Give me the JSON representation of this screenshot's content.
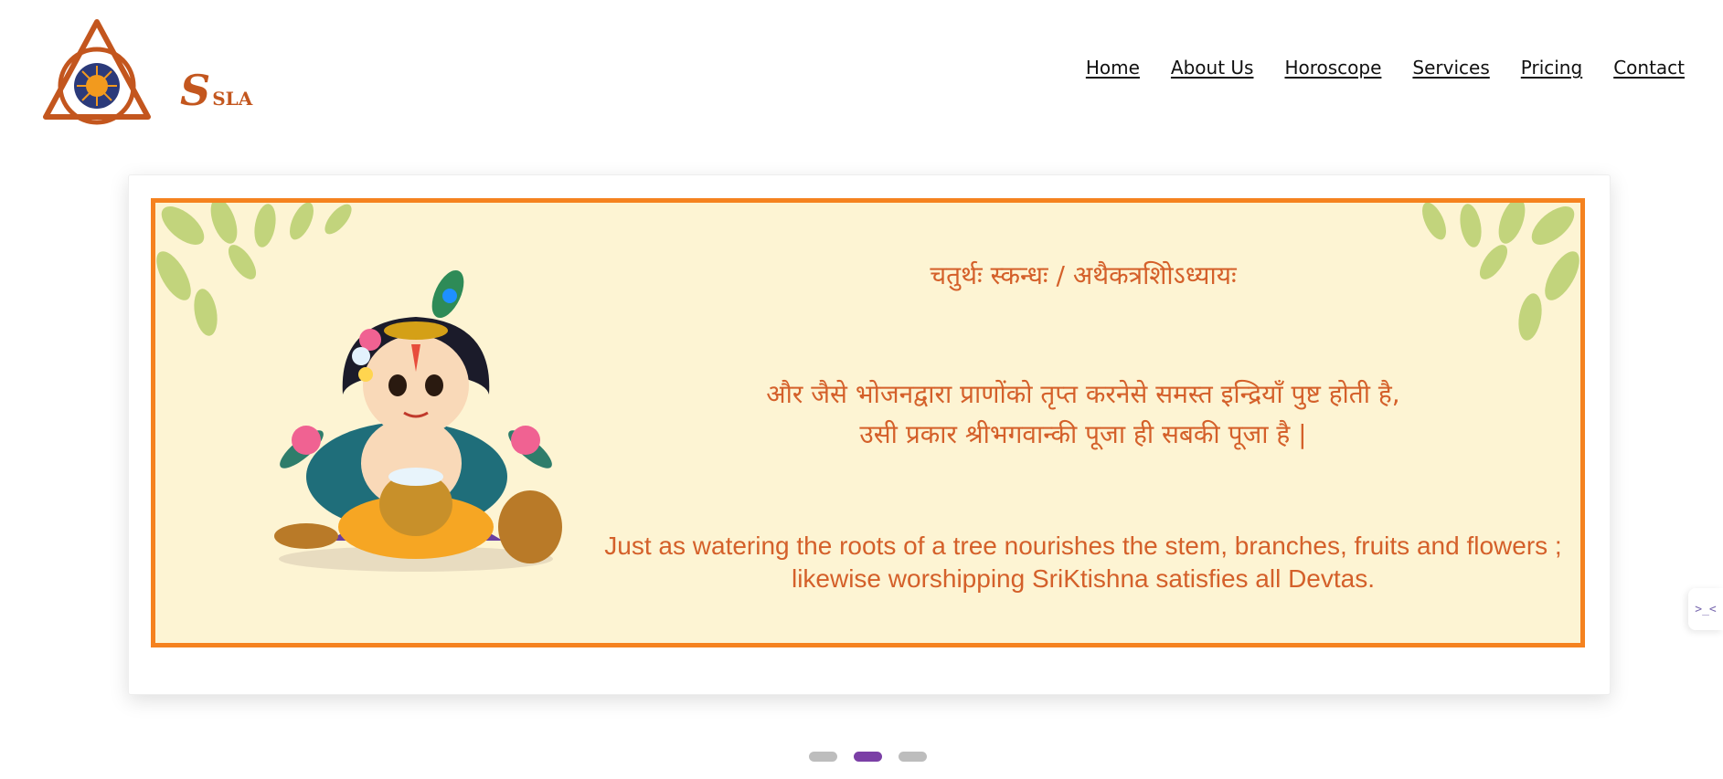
{
  "logo": {
    "letter": "S",
    "text": "SLA"
  },
  "nav": {
    "items": [
      {
        "label": "Home"
      },
      {
        "label": "About Us"
      },
      {
        "label": "Horoscope"
      },
      {
        "label": "Services"
      },
      {
        "label": "Pricing"
      },
      {
        "label": "Contact"
      }
    ]
  },
  "slide": {
    "title": "चतुर्थः स्कन्धः / अथैकत्रशिोऽध्यायः",
    "hindi_line_1": "और जैसे भोजनद्वारा प्राणोंको तृप्त करनेसे समस्त इन्द्रियाँ पुष्ट होती है,",
    "hindi_line_2": "उसी प्रकार श्रीभगवान्की पूजा ही सबकी पूजा है |",
    "english_line_1": "Just as watering the roots of a tree nourishes the stem, branches, fruits and flowers ;",
    "english_line_2": "likewise worshipping SriKtishna satisfies all Devtas."
  },
  "carousel": {
    "total": 3,
    "active_index": 1
  },
  "side_widget": {
    "icon": "code-icon",
    "glyph": ">_<"
  },
  "colors": {
    "brand": "#c3561e",
    "banner_border": "#f5821f",
    "banner_bg": "#fdf4d3",
    "slide_text": "#d4602a",
    "active_dot": "#7b3fa6"
  }
}
